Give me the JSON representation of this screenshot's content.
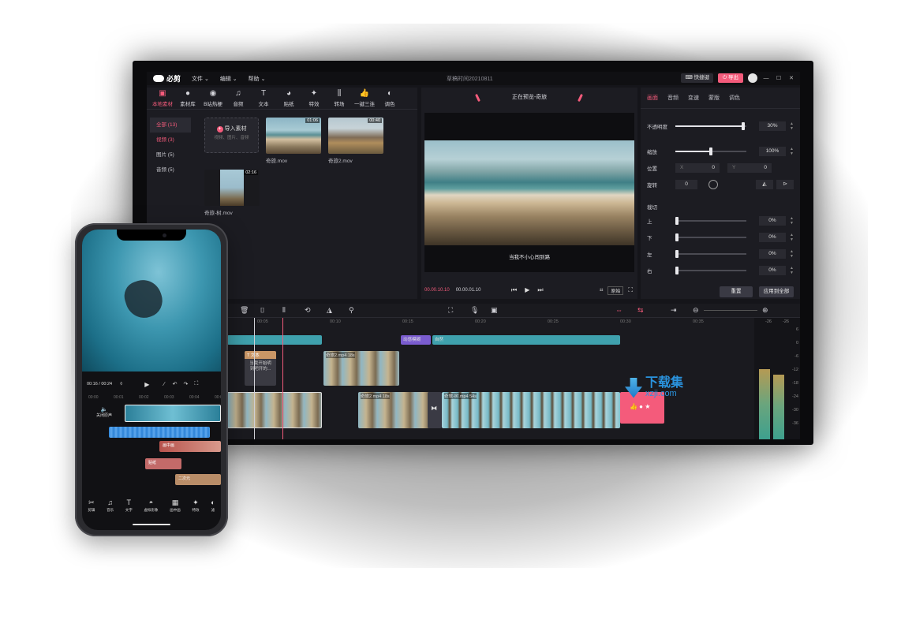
{
  "app": {
    "logo_text": "必剪",
    "menu": [
      "文件 ⌄",
      "编辑 ⌄",
      "帮助 ⌄"
    ],
    "doc_title": "草稿时间20210811",
    "shortcut_label": "快捷键",
    "export_label": "导出",
    "window_controls": [
      "—",
      "☐",
      "✕"
    ]
  },
  "media": {
    "tools": [
      {
        "icon": "▣",
        "label": "本地素材",
        "name": "local-media"
      },
      {
        "icon": "●",
        "label": "素材库",
        "name": "media-library"
      },
      {
        "icon": "◉",
        "label": "B站热梗",
        "name": "bilibili-memes"
      },
      {
        "icon": "♫",
        "label": "音频",
        "name": "audio"
      },
      {
        "icon": "T",
        "label": "文本",
        "name": "text"
      },
      {
        "icon": "◕",
        "label": "贴纸",
        "name": "stickers"
      },
      {
        "icon": "✦",
        "label": "特效",
        "name": "effects"
      },
      {
        "icon": "⫼",
        "label": "转场",
        "name": "transitions"
      },
      {
        "icon": "👍",
        "label": "一键三连",
        "name": "triple-like"
      },
      {
        "icon": "◐",
        "label": "调色",
        "name": "color-grade"
      }
    ],
    "categories": [
      "全部 (13)",
      "视频 (3)",
      "图片 (5)",
      "音频 (5)"
    ],
    "import": {
      "title": "导入素材",
      "hint": "视频、图片、音频"
    },
    "clips": [
      {
        "name": "奇旅.mov",
        "duration": "01:06"
      },
      {
        "name": "奇旅2.mov",
        "duration": "00:40"
      },
      {
        "name": "奇旅-树.mov",
        "duration": "02:16"
      }
    ]
  },
  "preview": {
    "title": "正在预览-奇旅",
    "subtitle": "当我不小心闯到路",
    "time_current": "00.00.10.10",
    "time_total": "00.00.01.10",
    "original_label": "原始"
  },
  "props": {
    "tabs": [
      "画面",
      "音频",
      "变速",
      "蒙版",
      "调色"
    ],
    "opacity": {
      "label": "不透明度",
      "value": "30%",
      "level": 0.95
    },
    "scale": {
      "label": "缩放",
      "value": "100%",
      "level": 0.5
    },
    "position": {
      "label": "位置",
      "x_axis": "X",
      "x": "0",
      "y_axis": "Y",
      "y": "0"
    },
    "rotation": {
      "label": "旋转",
      "value": "0"
    },
    "crop": {
      "label": "裁切",
      "rows": [
        {
          "label": "上",
          "value": "0%"
        },
        {
          "label": "下",
          "value": "0%"
        },
        {
          "label": "左",
          "value": "0%"
        },
        {
          "label": "右",
          "value": "0%"
        }
      ]
    },
    "reset_label": "重置",
    "apply_label": "应用到全部"
  },
  "timeline": {
    "ticks": [
      "00:05",
      "00:10",
      "00:15",
      "00:20",
      "00:25",
      "00:30",
      "00:35"
    ],
    "text_clip": {
      "header": "T 文本",
      "body": "当我开始明\n到吧开的..."
    },
    "anim_label": "动感模糊",
    "nature_label": "自然",
    "clip_a_label": "奇旅2.mp4   18s",
    "clip_b_label": "奇旅2.mp4   18s",
    "clip_c_label": "奇旅-树.mp4   54s",
    "db_scale": [
      "-26",
      "-26",
      "6",
      "0",
      "-6",
      "-12",
      "-18",
      "-24",
      "-30",
      "-36"
    ],
    "meter_levels": [
      0.58,
      0.53
    ]
  },
  "phone": {
    "time": "00:16 / 00:24",
    "ruler": [
      "00:00",
      "00:01",
      "00:02",
      "00:03",
      "00:04",
      "00:05"
    ],
    "mute_label": "关闭原声",
    "tracks": [
      {
        "label": "画中画"
      },
      {
        "label": "贴纸"
      },
      {
        "label": "二次元"
      }
    ],
    "tools": [
      {
        "icon": "✂",
        "label": "剪辑"
      },
      {
        "icon": "♫",
        "label": "音乐"
      },
      {
        "icon": "T",
        "label": "文字"
      },
      {
        "icon": "◓",
        "label": "虚拟形象"
      },
      {
        "icon": "▦",
        "label": "画中画"
      },
      {
        "icon": "✦",
        "label": "特效"
      },
      {
        "icon": "◐",
        "label": "滤"
      }
    ]
  },
  "watermark": {
    "line1": "下载集",
    "line2": "xzji.com"
  },
  "colors": {
    "accent": "#f45b7b",
    "track_teal": "#3fa1ad",
    "panel": "#1c1c22"
  }
}
